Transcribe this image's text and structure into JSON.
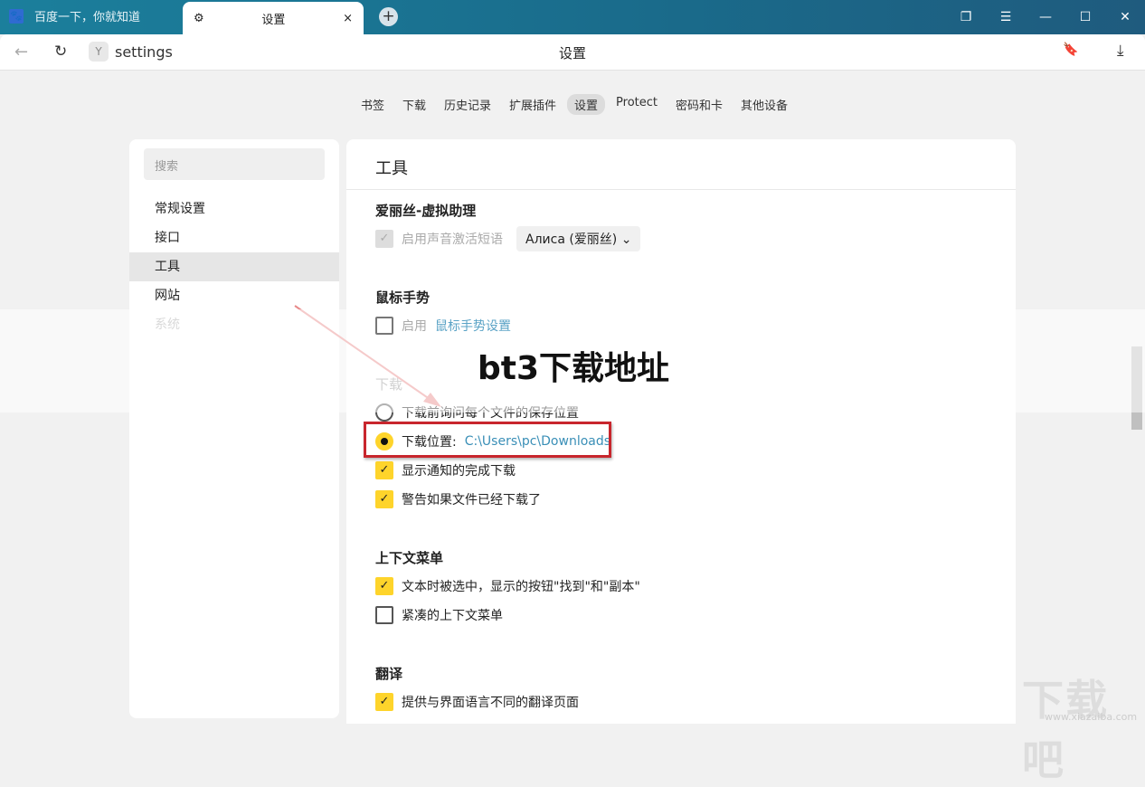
{
  "tabs": [
    {
      "label": "百度一下，你就知道",
      "icon": "baidu-paw-icon"
    },
    {
      "label": "设置",
      "icon": "gear-icon",
      "close": "×"
    }
  ],
  "new_tab": "+",
  "address": {
    "url": "settings",
    "title": "设置"
  },
  "nav": [
    "书签",
    "下载",
    "历史记录",
    "扩展插件",
    "设置",
    "Protect",
    "密码和卡",
    "其他设备"
  ],
  "nav_active": 4,
  "sidebar": {
    "search_placeholder": "搜索",
    "items": [
      "常规设置",
      "接口",
      "工具",
      "网站",
      "系统"
    ]
  },
  "main": {
    "title": "工具",
    "alice": {
      "heading": "爱丽丝-虚拟助理",
      "option": "启用声音激活短语",
      "select": "Алиса (爱丽丝)"
    },
    "gestures": {
      "heading": "鼠标手势",
      "enable": "启用",
      "settings_link": "鼠标手势设置"
    },
    "download": {
      "heading": "下载",
      "ask": "下载前询问每个文件的保存位置",
      "location_label": "下载位置:",
      "location": "C:\\Users\\pc\\Downloads",
      "notify": "显示通知的完成下载",
      "warn": "警告如果文件已经下载了"
    },
    "context": {
      "heading": "上下文菜单",
      "show_buttons": "文本时被选中，显示的按钮\"找到\"和\"副本\"",
      "compact": "紧凑的上下文菜单"
    },
    "translate": {
      "heading": "翻译",
      "offer": "提供与界面语言不同的翻译页面"
    }
  },
  "overlay_text": "bt3下载地址",
  "watermark": {
    "logo": "下载吧",
    "url": "www.xiazaiba.com"
  },
  "accent": "#fed42b"
}
